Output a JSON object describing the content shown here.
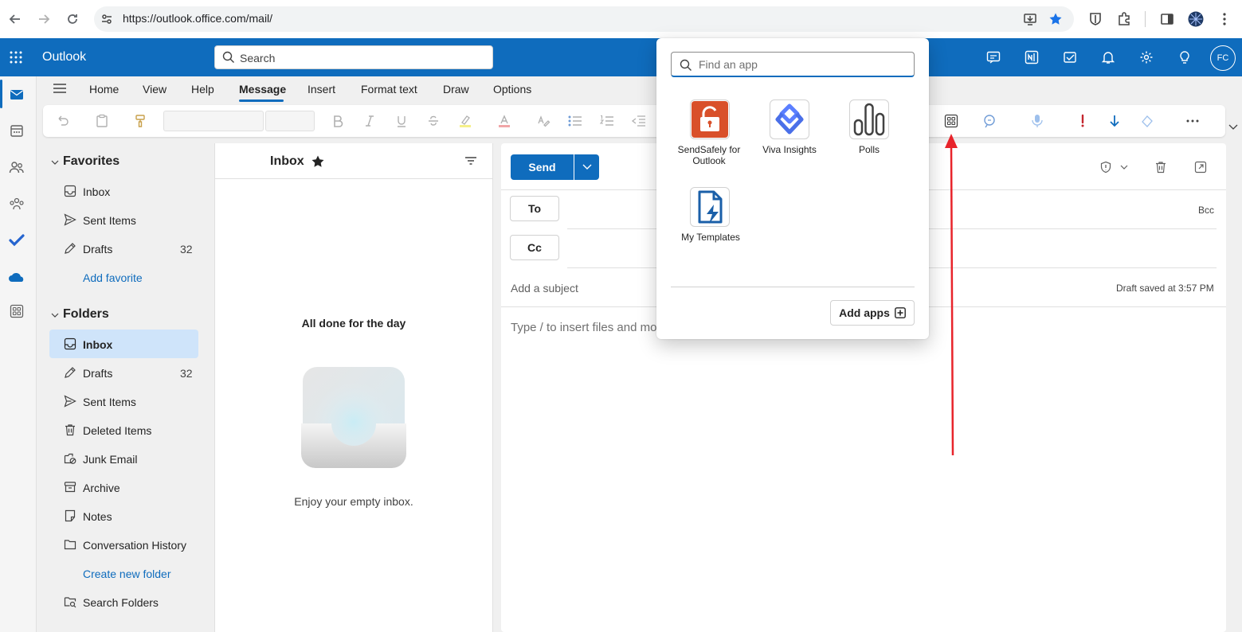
{
  "browser": {
    "url": "https://outlook.office.com/mail/"
  },
  "header": {
    "brand": "Outlook",
    "search_placeholder": "Search",
    "avatar_initials": "FC"
  },
  "ribbon": {
    "tabs": [
      "Home",
      "View",
      "Help",
      "Message",
      "Insert",
      "Format text",
      "Draw",
      "Options"
    ],
    "active_tab": "Message"
  },
  "folders": {
    "favorites_title": "Favorites",
    "favorites": [
      {
        "label": "Inbox",
        "count": "",
        "icon": "inbox-icon"
      },
      {
        "label": "Sent Items",
        "count": "",
        "icon": "send-icon"
      },
      {
        "label": "Drafts",
        "count": "32",
        "icon": "pencil-icon"
      }
    ],
    "add_favorite": "Add favorite",
    "folders_title": "Folders",
    "items": [
      {
        "label": "Inbox",
        "count": "",
        "icon": "inbox-icon",
        "selected": true
      },
      {
        "label": "Drafts",
        "count": "32",
        "icon": "pencil-icon"
      },
      {
        "label": "Sent Items",
        "count": "",
        "icon": "send-icon"
      },
      {
        "label": "Deleted Items",
        "count": "",
        "icon": "trash-icon"
      },
      {
        "label": "Junk Email",
        "count": "",
        "icon": "junk-icon"
      },
      {
        "label": "Archive",
        "count": "",
        "icon": "archive-icon"
      },
      {
        "label": "Notes",
        "count": "",
        "icon": "note-icon"
      },
      {
        "label": "Conversation History",
        "count": "",
        "icon": "folder-icon"
      }
    ],
    "create_folder": "Create new folder",
    "search_folders": "Search Folders"
  },
  "message_list": {
    "title": "Inbox",
    "empty_title": "All done for the day",
    "empty_subtitle": "Enjoy your empty inbox."
  },
  "compose": {
    "send_label": "Send",
    "to_label": "To",
    "cc_label": "Cc",
    "bcc_label": "Bcc",
    "subject_placeholder": "Add a subject",
    "draft_status": "Draft saved at 3:57 PM",
    "body_placeholder": "Type / to insert files and mo"
  },
  "app_popup": {
    "search_placeholder": "Find an app",
    "apps": [
      {
        "label_line1": "SendSafely for",
        "label_line2": "Outlook",
        "icon": "sendsafely-icon",
        "color": "#d9502a"
      },
      {
        "label_line1": "Viva Insights",
        "label_line2": "",
        "icon": "viva-insights-icon",
        "color": "#5b7fff"
      },
      {
        "label_line1": "Polls",
        "label_line2": "",
        "icon": "polls-icon",
        "color": "#424242"
      },
      {
        "label_line1": "My Templates",
        "label_line2": "",
        "icon": "templates-icon",
        "color": "#1a5fa8"
      }
    ],
    "add_apps_label": "Add apps"
  },
  "colors": {
    "brand_blue": "#0f6cbd",
    "annotation_red": "#e8242b"
  }
}
